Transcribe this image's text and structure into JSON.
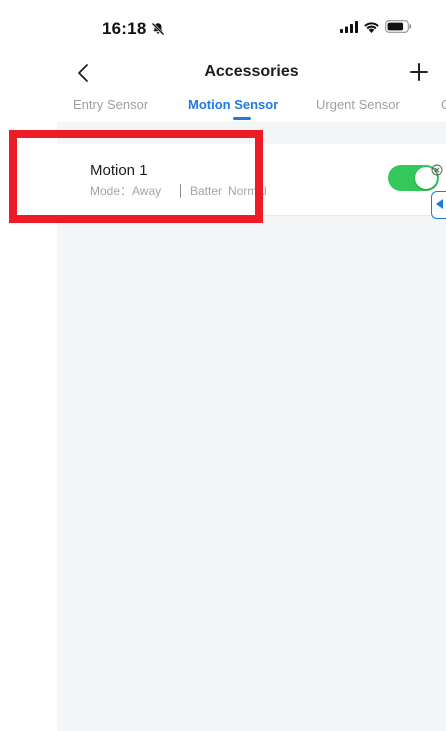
{
  "status_bar": {
    "time": "16:18",
    "mute_icon": "bell-slash-icon",
    "signal_icon": "cellular-signal-icon",
    "wifi_icon": "wifi-icon",
    "battery_icon": "battery-icon"
  },
  "nav": {
    "back_icon": "chevron-left-icon",
    "title": "Accessories",
    "add_icon": "plus-icon"
  },
  "tabs": [
    {
      "label": "Entry Sensor",
      "active": false
    },
    {
      "label": "Motion Sensor",
      "active": true
    },
    {
      "label": "Urgent Sensor",
      "active": false
    },
    {
      "label": "C",
      "active": false
    }
  ],
  "devices": [
    {
      "name": "Motion 1",
      "mode": "Mode：Away",
      "battery_label": "Batter",
      "battery_status": "Normal",
      "enabled": true
    }
  ],
  "colors": {
    "accent": "#1f7ae0",
    "toggle_on": "#34c759",
    "highlight": "#ee1c25",
    "background": "#f4f5f7"
  }
}
